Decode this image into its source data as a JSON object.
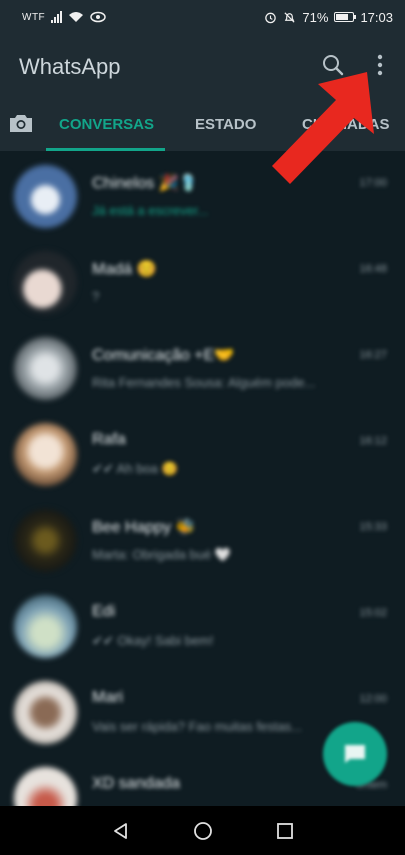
{
  "status_bar": {
    "carrier": "WTF",
    "battery": "71%",
    "time": "17:03"
  },
  "header": {
    "title": "WhatsApp",
    "search_icon": "search-icon",
    "menu_icon": "more-vert-icon"
  },
  "tabs": [
    {
      "label": "CONVERSAS",
      "active": true
    },
    {
      "label": "ESTADO",
      "active": false
    },
    {
      "label": "CHAMADAS",
      "active": false
    }
  ],
  "chats": [
    {
      "name": "Chinelos 🎉🩴",
      "message": "Já está a escrever...",
      "time": "17:00"
    },
    {
      "name": "Madá 😊",
      "message": "?",
      "time": "16:48"
    },
    {
      "name": "Comunicação +E🤝",
      "message": "Rita Fernandes Sousa: Alguém pode...",
      "time": "16:27"
    },
    {
      "name": "Rafa",
      "message": "✔✔ Ah boa 😊",
      "time": "16:12"
    },
    {
      "name": "Bee Happy 🐝",
      "message": "Marta: Obrigada bué 🤍",
      "time": "15:33"
    },
    {
      "name": "Edi",
      "message": "✔✔ Okay! Sabi bem!",
      "time": "15:02"
    },
    {
      "name": "Mari",
      "message": "Vais ser rápida? Fao muitas festas...",
      "time": "12:00"
    },
    {
      "name": "XD sandada",
      "message": "",
      "time": "ontem"
    }
  ],
  "colors": {
    "accent": "#12a58a",
    "header_bg": "#1f2c33",
    "list_bg": "#0f1c22",
    "annotation": "#e8281f"
  }
}
